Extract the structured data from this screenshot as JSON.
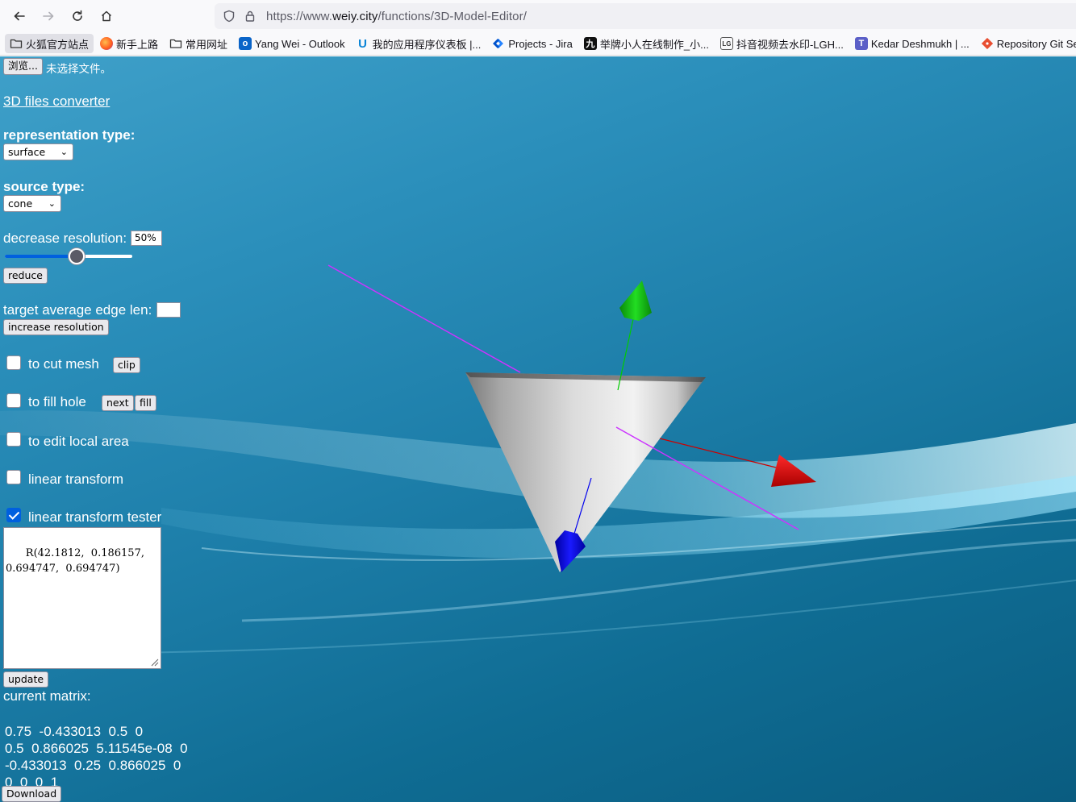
{
  "browser": {
    "url_prefix": "https://www.",
    "url_domain": "weiy.city",
    "url_path": "/functions/3D-Model-Editor/",
    "bookmarks": [
      {
        "label": "火狐官方站点",
        "icon": "folder-icon"
      },
      {
        "label": "新手上路",
        "icon": "firefox-icon"
      },
      {
        "label": "常用网址",
        "icon": "folder-icon"
      },
      {
        "label": "Yang Wei - Outlook",
        "icon": "outlook-icon"
      },
      {
        "label": "我的应用程序仪表板 |...",
        "icon": "u-icon"
      },
      {
        "label": "Projects - Jira",
        "icon": "jira-icon"
      },
      {
        "label": "举牌小人在线制作_小...",
        "icon": "jiu-icon"
      },
      {
        "label": "抖音视频去水印-LGH...",
        "icon": "lg-icon"
      },
      {
        "label": "Kedar Deshmukh | ...",
        "icon": "teams-icon"
      },
      {
        "label": "Repository Git Server",
        "icon": "git-icon"
      }
    ]
  },
  "panel": {
    "browse_button": "浏览...",
    "no_file_text": "未选择文件。",
    "converter_link": "3D files converter",
    "representation_label": "representation type:",
    "representation_value": "surface",
    "source_label": "source type:",
    "source_value": "cone",
    "decrease_label": "decrease resolution:",
    "decrease_value": "50%",
    "decrease_slider_fraction": 0.5,
    "reduce_button": "reduce",
    "target_edge_label": "target average edge len:",
    "target_edge_value": "",
    "increase_button": "increase resolution",
    "cut_mesh_label": "to cut mesh",
    "clip_button": "clip",
    "fill_hole_label": "to fill hole",
    "next_button": "next",
    "fill_button": "fill",
    "edit_local_label": "to edit local area",
    "linear_transform_label": "linear transform",
    "tester_label": "linear transform tester",
    "tester_checked": true,
    "tester_text": "R(42.1812,  0.186157,\n0.694747,  0.694747)",
    "update_button": "update",
    "current_matrix_label": "current matrix:",
    "matrix_rows": [
      "0.75  -0.433013  0.5  0",
      "0.5  0.866025  5.11545e-08  0",
      "-0.433013  0.25  0.866025  0",
      "0  0  0  1"
    ],
    "download_button": "Download"
  },
  "colors": {
    "x_axis": "#ff0000",
    "y_axis": "#00cc00",
    "z_axis": "#0000ff",
    "clip_line": "#cc33ff",
    "checkbox_accent": "#0060df"
  }
}
